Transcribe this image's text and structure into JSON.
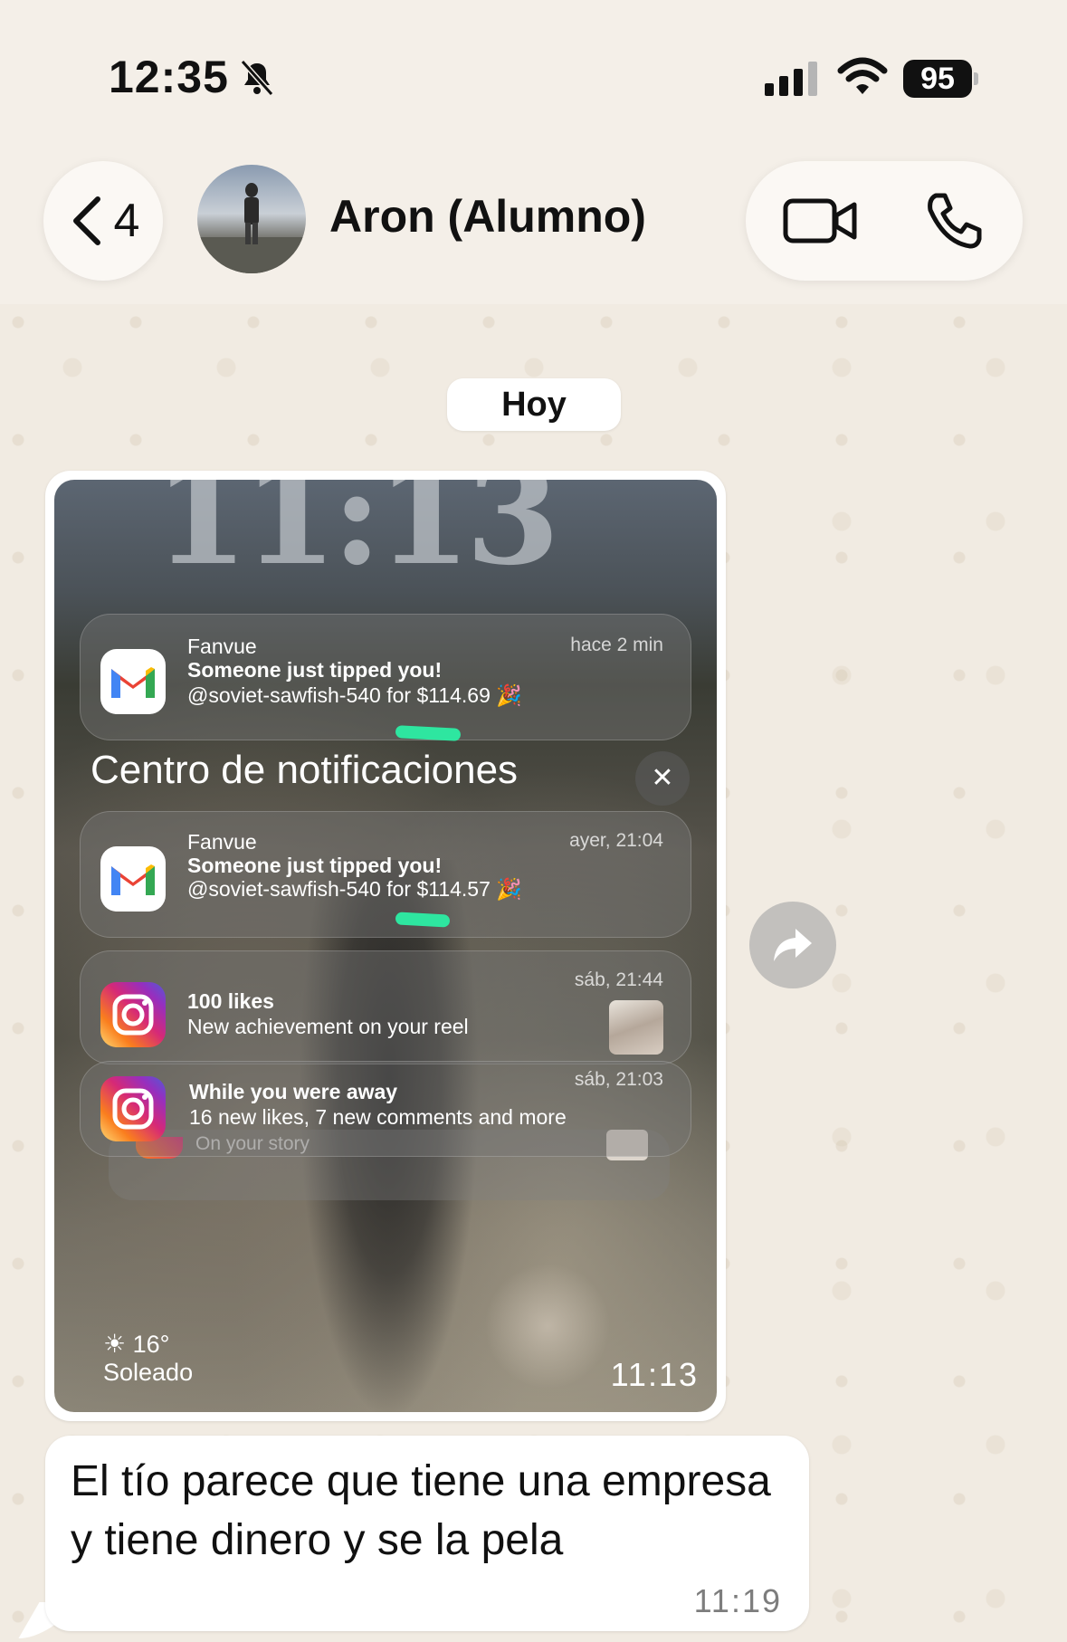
{
  "status_bar": {
    "time": "12:35",
    "battery": "95"
  },
  "header": {
    "back_count": "4",
    "contact_name": "Aron (Alumno)"
  },
  "chat": {
    "date_chip": "Hoy",
    "screenshot": {
      "clock": "11:13",
      "top_notification": {
        "app": "Fanvue",
        "time": "hace 2 min",
        "title": "Someone just tipped you!",
        "body": "@soviet-sawfish-540 for $114.69 🎉",
        "icon": "gmail-icon"
      },
      "notification_center_title": "Centro de notificaciones",
      "notifications": [
        {
          "app": "Fanvue",
          "time": "ayer, 21:04",
          "title": "Someone just tipped you!",
          "body": "@soviet-sawfish-540 for $114.57 🎉",
          "icon": "gmail-icon"
        },
        {
          "time": "sáb, 21:44",
          "title": "100 likes",
          "body": "New achievement on your reel",
          "icon": "instagram-icon"
        },
        {
          "time": "sáb, 21:03",
          "title": "While you were away",
          "body": "16 new likes, 7 new comments and more",
          "icon": "instagram-icon"
        }
      ],
      "stacked_hint": "On your story",
      "weather_temp": "16°",
      "weather_desc": "Soleado",
      "bottom_time": "11:13"
    },
    "message": {
      "text": "El tío parece que tiene una empresa y tiene dinero y se la pela",
      "time": "11:19"
    }
  },
  "colors": {
    "background": "#f4efe8",
    "bubble": "#ffffff",
    "highlight_marker": "#2ee6a0"
  }
}
